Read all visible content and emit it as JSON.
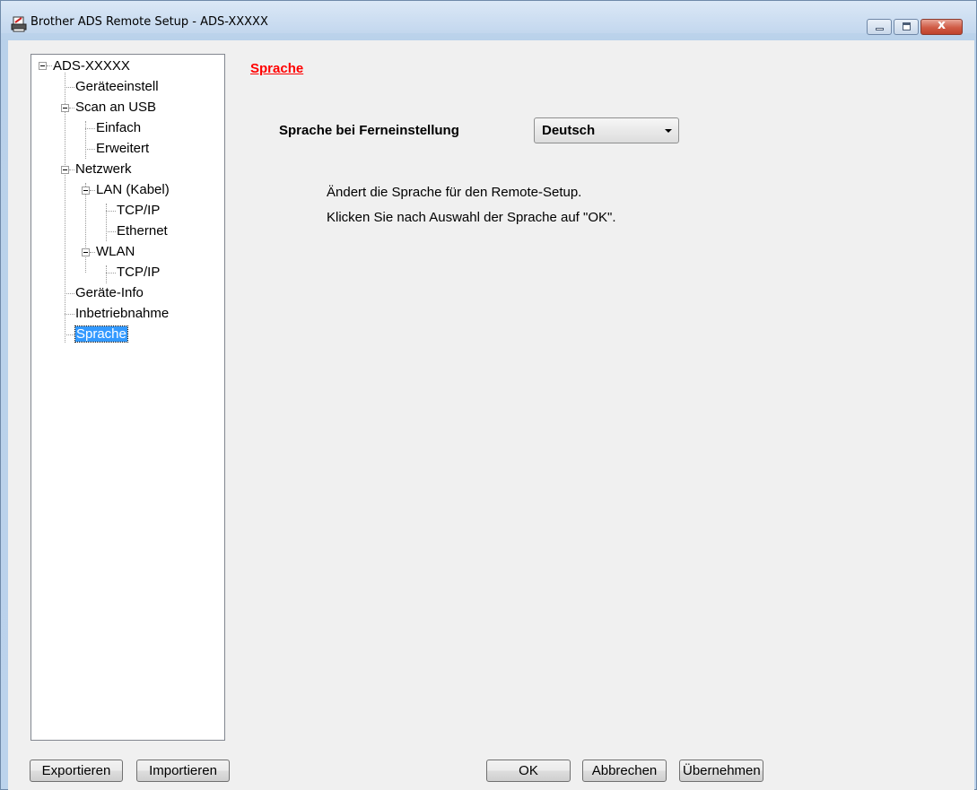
{
  "window": {
    "title": "Brother ADS Remote Setup - ADS-XXXXX",
    "close_glyph": "x"
  },
  "tree": {
    "root": "ADS-XXXXX",
    "items": [
      {
        "label": "Geräteeinstell"
      },
      {
        "label": "Scan an USB"
      },
      {
        "label": "Einfach"
      },
      {
        "label": "Erweitert"
      },
      {
        "label": "Netzwerk"
      },
      {
        "label": "LAN (Kabel)"
      },
      {
        "label": "TCP/IP"
      },
      {
        "label": "Ethernet"
      },
      {
        "label": "WLAN"
      },
      {
        "label": "TCP/IP"
      },
      {
        "label": "Geräte-Info"
      },
      {
        "label": "Inbetriebnahme"
      },
      {
        "label": "Sprache"
      }
    ],
    "selected": "Sprache"
  },
  "panel": {
    "title": "Sprache",
    "language_label": "Sprache bei Ferneinstellung",
    "language_value": "Deutsch",
    "description_1": "Ändert die Sprache für den Remote-Setup.",
    "description_2": "Klicken Sie nach Auswahl der Sprache auf \"OK\"."
  },
  "buttons": {
    "export": "Exportieren",
    "import": "Importieren",
    "ok": "OK",
    "cancel": "Abbrechen",
    "apply": "Übernehmen"
  },
  "colors": {
    "section_title": "#ff0000",
    "selection": "#3399ff"
  }
}
